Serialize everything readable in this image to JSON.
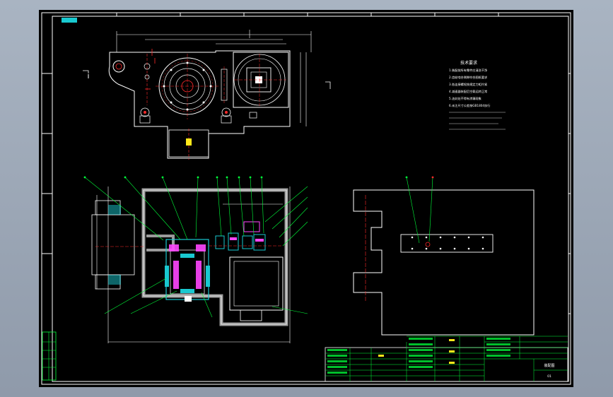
{
  "colors": {
    "background": "#000000",
    "frame": "#ffffff",
    "green": "#00ff3a",
    "cyan": "#19c9d0",
    "red": "#ff2a2a",
    "yellow": "#ffe81a",
    "magenta": "#ff46ff",
    "gray": "#9a9a9a"
  },
  "drawing": {
    "notes_title": "技术要求",
    "notes": [
      "1.装配前所有零件应清洗干净",
      "2.齿轮啮合侧隙符合图纸要求",
      "3.各连接螺栓按规定力矩拧紧",
      "4.减速器装配后空载运转正常",
      "5.油封处不得有渗漏现象",
      "6.未注尺寸公差按GB1804执行"
    ],
    "title_block": {
      "title": "装配图",
      "drawing_no": "01"
    }
  }
}
